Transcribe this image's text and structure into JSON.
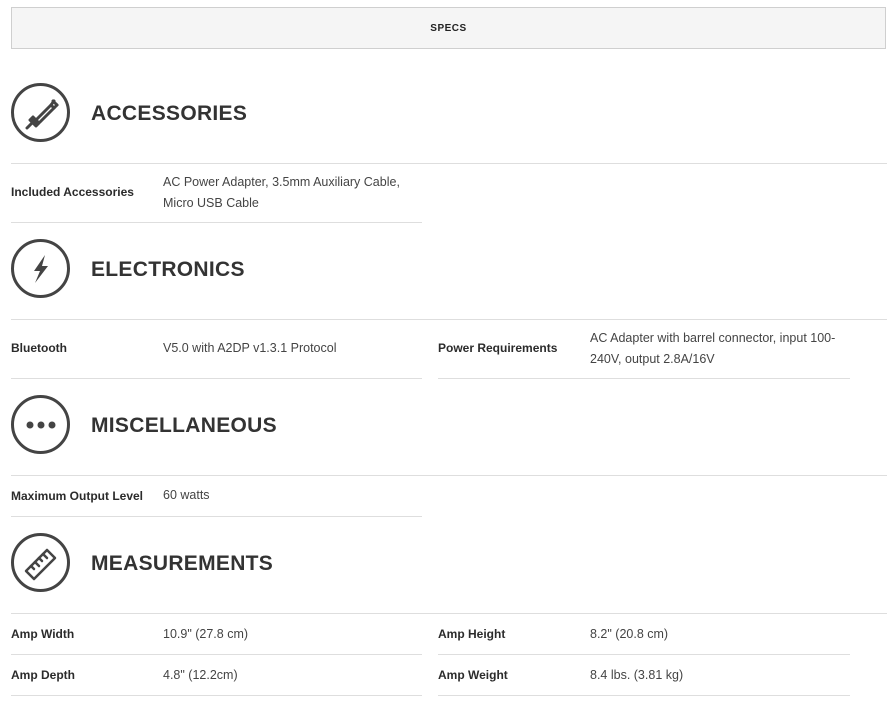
{
  "tab": {
    "label": "SPECS"
  },
  "sections": {
    "accessories": {
      "title": "ACCESSORIES",
      "icon": "audio-cable-icon",
      "rows": [
        {
          "label": "Included Accessories",
          "value": "AC Power Adapter, 3.5mm Auxiliary Cable, Micro USB Cable"
        }
      ]
    },
    "electronics": {
      "title": "ELECTRONICS",
      "icon": "lightning-bolt-icon",
      "rows": [
        {
          "label": "Bluetooth",
          "value": "V5.0 with A2DP v1.3.1 Protocol"
        },
        {
          "label": "Power Requirements",
          "value": "AC Adapter with barrel connector, input 100-240V, output 2.8A/16V"
        }
      ]
    },
    "miscellaneous": {
      "title": "MISCELLANEOUS",
      "icon": "more-dots-icon",
      "rows": [
        {
          "label": "Maximum Output Level",
          "value": "60 watts"
        }
      ]
    },
    "measurements": {
      "title": "MEASUREMENTS",
      "icon": "ruler-icon",
      "rows": [
        {
          "label": "Amp Width",
          "value": "10.9\" (27.8 cm)"
        },
        {
          "label": "Amp Height",
          "value": "8.2\" (20.8 cm)"
        },
        {
          "label": "Amp Depth",
          "value": "4.8\" (12.2cm)"
        },
        {
          "label": "Amp Weight",
          "value": "8.4 lbs. (3.81 kg)"
        }
      ]
    }
  },
  "colors": {
    "icon": "#444444",
    "divider": "#dedede",
    "tab_bg": "#f5f5f5"
  }
}
